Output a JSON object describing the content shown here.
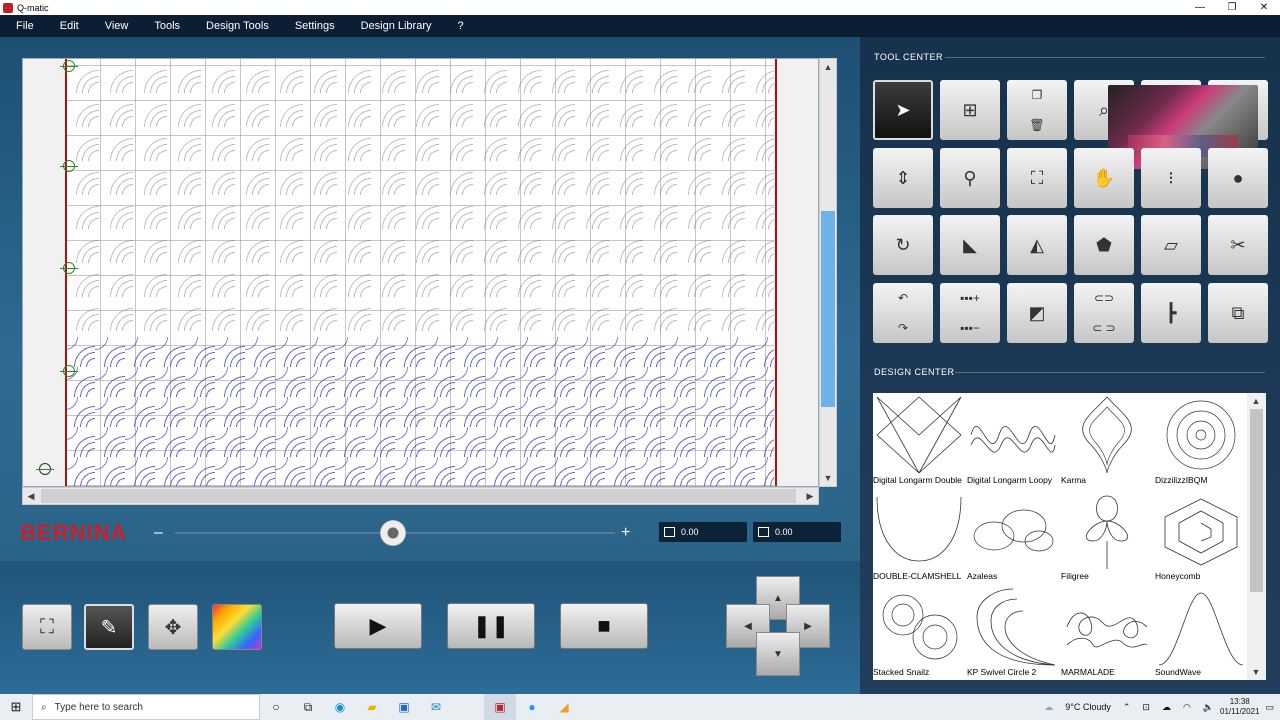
{
  "window": {
    "title": "Q-matic",
    "minimize": "—",
    "restore": "❐",
    "close": "✕"
  },
  "menu": [
    "File",
    "Edit",
    "View",
    "Tools",
    "Design Tools",
    "Settings",
    "Design Library",
    "?"
  ],
  "brand": "BERNINA",
  "zoom": {
    "minus": "–",
    "plus": "+"
  },
  "coords": {
    "x": "0.00",
    "y": "0.00"
  },
  "tool_center": {
    "title": "TOOL CENTER"
  },
  "design_center": {
    "title": "DESIGN CENTER",
    "designs": [
      "Digital Longarm Double",
      "Digital Longarm Loopy",
      "Karma",
      "DizzilizzIBQM",
      "DOUBLE-CLAMSHELL",
      "Azaleas",
      "Filigree",
      "Honeycomb",
      "Stacked Snailz",
      "KP Swivel Circle 2",
      "MARMALADE",
      "SoundWave"
    ]
  },
  "taskbar": {
    "search_placeholder": "Type here to search",
    "weather": "9°C Cloudy",
    "time": "13:38",
    "date": "01/11/2021"
  }
}
